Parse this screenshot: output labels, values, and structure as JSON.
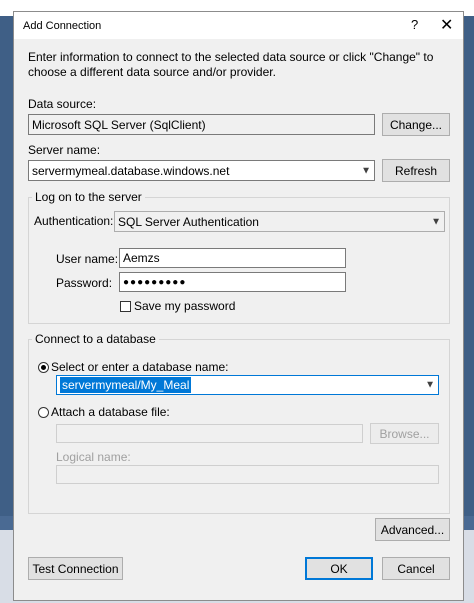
{
  "window": {
    "title": "Add Connection",
    "help": "?",
    "close": "✕"
  },
  "intro": "Enter information to connect to the selected data source or click \"Change\" to choose a different data source and/or provider.",
  "datasource": {
    "label": "Data source:",
    "value": "Microsoft SQL Server (SqlClient)",
    "change_button": "Change..."
  },
  "server": {
    "label": "Server name:",
    "value": "servermymeal.database.windows.net",
    "refresh_button": "Refresh"
  },
  "logon": {
    "title": "Log on to the server",
    "auth_label": "Authentication:",
    "auth_value": "SQL Server Authentication",
    "username_label": "User name:",
    "username_value": "Aemzs",
    "password_label": "Password:",
    "password_value": "●●●●●●●●●",
    "save_password_label": "Save my password",
    "save_password_checked": false
  },
  "database": {
    "title": "Connect to a database",
    "select_label": "Select or enter a database name:",
    "select_value": "servermymeal/My_Meal",
    "attach_label": "Attach a database file:",
    "browse_button": "Browse...",
    "logical_label": "Logical name:"
  },
  "buttons": {
    "advanced": "Advanced...",
    "test": "Test Connection",
    "ok": "OK",
    "cancel": "Cancel"
  },
  "colors": {
    "accent": "#0078d7",
    "dialog_bg": "#f0f0f0",
    "desktop": "#3f5f86"
  }
}
